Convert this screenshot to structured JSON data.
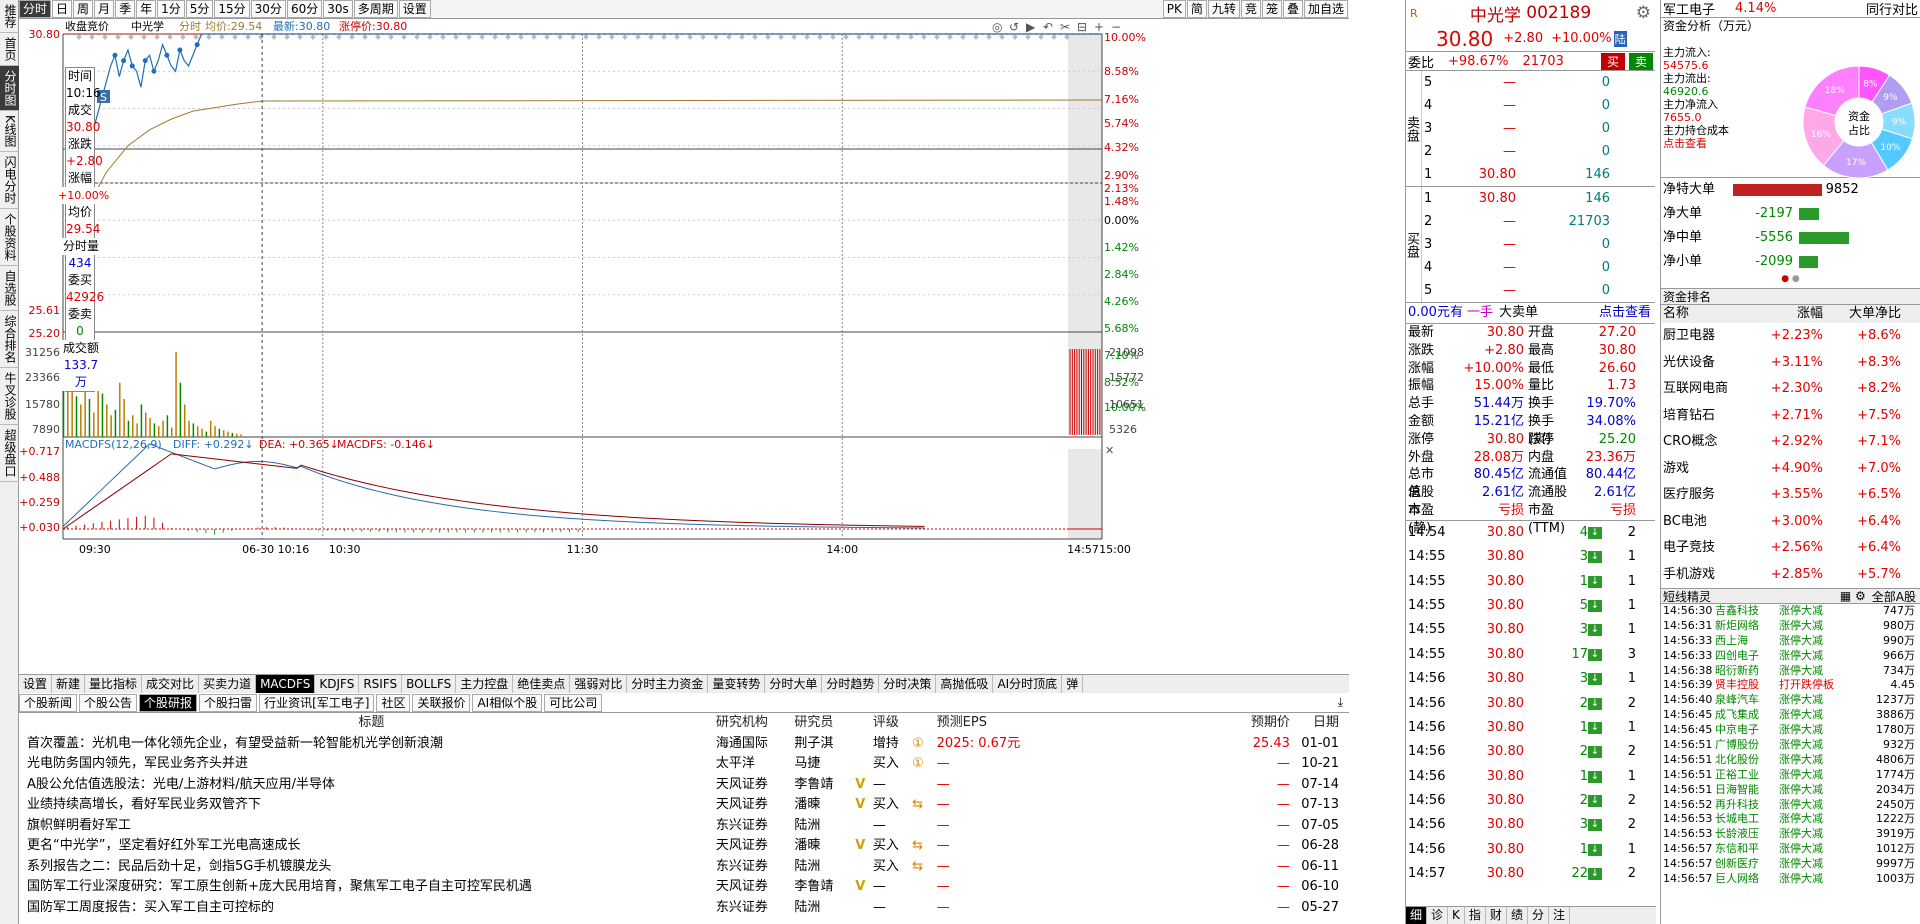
{
  "leftnav": [
    "推荐",
    "首页",
    "分时图",
    "K线图",
    "闪电分时",
    "个股资料",
    "自选股",
    "综合排名",
    "牛叉诊股",
    "超级盘口"
  ],
  "toolbar": {
    "items": [
      "分时",
      "日",
      "周",
      "月",
      "季",
      "年",
      "1分",
      "5分",
      "15分",
      "30分",
      "60分",
      "30s",
      "多周期",
      "设置"
    ],
    "right": [
      "PK",
      "简",
      "九转",
      "竞",
      "笼",
      "叠",
      "加自选"
    ]
  },
  "chart": {
    "legend": {
      "collect": "收盘竞价",
      "name": "中光学",
      "ma_label": "分时",
      "avg_label": "均价:29.54",
      "latest_label": "最新:30.80",
      "limit_label": "涨停价:30.80"
    },
    "price_axis": {
      "left": [
        "30.80",
        "25.61",
        "25.20"
      ],
      "right": [
        "10.00%",
        "8.58%",
        "7.16%",
        "5.74%",
        "4.32%",
        "2.90%",
        "2.13%",
        "1.48%",
        "0.00%",
        "1.42%",
        "2.84%",
        "4.26%",
        "5.68%",
        "7.10%",
        "8.52%",
        "10.00%"
      ]
    },
    "vol_axis": {
      "left": [
        "31256",
        "23366",
        "15780",
        "7890"
      ],
      "right": [
        "21098",
        "15772",
        "10651",
        "5326"
      ]
    },
    "macd_legend": {
      "name": "MACDFS(12,26,9)",
      "diff": "DIFF: +0.292↓",
      "dea": "DEA: +0.365↓",
      "macdfs": "MACDFS: -0.146↓"
    },
    "macd_axis": [
      "+0.717",
      "+0.488",
      "+0.259",
      "+0.030"
    ],
    "time_axis": [
      "09:30",
      "06-30 10:16",
      "10:30",
      "11:30",
      "14:00",
      "14:57",
      "15:00"
    ],
    "marker": "S"
  },
  "infobox": {
    "time_l": "时间",
    "time": "10:16",
    "cj_l": "成交",
    "cj": "30.80",
    "zd_l": "涨跌",
    "zd": "+2.80",
    "zf_l": "涨幅",
    "zf": "+10.00%",
    "jj_l": "均价",
    "jj": "29.54",
    "fsl_l": "分时量",
    "fsl": "434",
    "wm_l": "委买",
    "wm": "42926",
    "ws_l": "委卖",
    "ws": "0",
    "cje_l": "成交额",
    "cje": "133.7万"
  },
  "bottomtabs": [
    "设置",
    "新建",
    "量比指标",
    "成交对比",
    "买卖力道",
    "MACDFS",
    "KDJFS",
    "RSIFS",
    "BOLLFS",
    "主力控盘",
    "绝佳卖点",
    "强弱对比",
    "分时主力资金",
    "量变转势",
    "分时大单",
    "分时趋势",
    "分时决策",
    "高抛低吸",
    "AI分时顶底",
    "弹"
  ],
  "newstabs": [
    "个股新闻",
    "个股公告",
    "个股研报",
    "个股扫雷",
    "行业资讯[军工电子]",
    "社区",
    "关联报价",
    "AI相似个股",
    "可比公司"
  ],
  "news_header": {
    "title": "标题",
    "org": "研究机构",
    "analyst": "研究员",
    "rating": "评级",
    "eps": "预测EPS",
    "target": "预期价",
    "date": "日期"
  },
  "news": [
    {
      "title": "首次覆盖：光机电一体化领先企业，有望受益新一轮智能机光学创新浪潮",
      "org": "海通国际",
      "analyst": "荆子淇",
      "mark": "",
      "rating": "增持",
      "icon": "①",
      "eps": "2025: 0.67元",
      "target": "25.43",
      "date": "01-01"
    },
    {
      "title": "光电防务国内领先，军民业务齐头并进",
      "org": "太平洋",
      "analyst": "马捷",
      "mark": "",
      "rating": "买入",
      "icon": "①",
      "eps": "—",
      "target": "—",
      "date": "10-21"
    },
    {
      "title": "A股公允估值选股法：光电/上游材料/航天应用/半导体",
      "org": "天风证券",
      "analyst": "李鲁靖",
      "mark": "V",
      "rating": "—",
      "icon": "",
      "eps": "—",
      "target": "—",
      "date": "07-14"
    },
    {
      "title": "业绩持续高增长，看好军民业务双管齐下",
      "org": "天风证券",
      "analyst": "潘暕",
      "mark": "V",
      "rating": "买入",
      "icon": "⇆",
      "eps": "—",
      "target": "—",
      "date": "07-13"
    },
    {
      "title": "旗帜鲜明看好军工",
      "org": "东兴证券",
      "analyst": "陆洲",
      "mark": "",
      "rating": "—",
      "icon": "",
      "eps": "—",
      "target": "—",
      "date": "07-05"
    },
    {
      "title": "更名“中光学”，坚定看好红外军工光电高速成长",
      "org": "天风证券",
      "analyst": "潘暕",
      "mark": "V",
      "rating": "买入",
      "icon": "⇆",
      "eps": "—",
      "target": "—",
      "date": "06-28"
    },
    {
      "title": "系列报告之二：民品后劲十足，剑指5G手机镀膜龙头",
      "org": "东兴证券",
      "analyst": "陆洲",
      "mark": "",
      "rating": "买入",
      "icon": "⇆",
      "eps": "—",
      "target": "—",
      "date": "06-11"
    },
    {
      "title": "国防军工行业深度研究：军工原生创新+庞大民用培育，聚焦军工电子自主可控军民机遇",
      "org": "天风证券",
      "analyst": "李鲁靖",
      "mark": "V",
      "rating": "—",
      "icon": "",
      "eps": "—",
      "target": "—",
      "date": "06-10"
    },
    {
      "title": "国防军工周度报告：买入军工自主可控标的",
      "org": "东兴证券",
      "analyst": "陆洲",
      "mark": "",
      "rating": "—",
      "icon": "",
      "eps": "—",
      "target": "—",
      "date": "05-27"
    }
  ],
  "stock": {
    "badge": "R",
    "name": "中光学",
    "code": "002189",
    "price": "30.80",
    "change": "+2.80",
    "pct": "+10.00%",
    "tag": "陆",
    "wb_l": "委比",
    "wb": "+98.67%",
    "wc": "21703",
    "buy": "买",
    "sell": "卖"
  },
  "orderbook": {
    "sell_label": "卖盘",
    "buy_label": "买盘",
    "sell": [
      {
        "i": "5",
        "p": "—",
        "v": "0"
      },
      {
        "i": "4",
        "p": "—",
        "v": "0"
      },
      {
        "i": "3",
        "p": "—",
        "v": "0"
      },
      {
        "i": "2",
        "p": "—",
        "v": "0"
      },
      {
        "i": "1",
        "p": "30.80",
        "v": "146"
      }
    ],
    "buy": [
      {
        "i": "1",
        "p": "30.80",
        "v": "146"
      },
      {
        "i": "2",
        "p": "—",
        "v": "21703"
      },
      {
        "i": "3",
        "p": "—",
        "v": "0"
      },
      {
        "i": "4",
        "p": "—",
        "v": "0"
      },
      {
        "i": "5",
        "p": "—",
        "v": "0"
      }
    ]
  },
  "bigorder": {
    "amt": "0.00元有",
    "hands": "一手",
    "label": "大卖单",
    "link": "点击查看"
  },
  "stats": [
    [
      "最新",
      "30.80",
      "开盘",
      "27.20"
    ],
    [
      "涨跌",
      "+2.80",
      "最高",
      "30.80"
    ],
    [
      "涨幅",
      "+10.00%",
      "最低",
      "26.60"
    ],
    [
      "振幅",
      "15.00%",
      "量比",
      "1.73"
    ],
    [
      "总手",
      "51.44万",
      "换手",
      "19.70%"
    ],
    [
      "金额",
      "15.21亿",
      "换手(实)",
      "34.08%"
    ],
    [
      "涨停",
      "30.80",
      "跌停",
      "25.20"
    ],
    [
      "外盘",
      "28.08万",
      "内盘",
      "23.36万"
    ],
    [
      "总市值",
      "80.45亿",
      "流通值",
      "80.44亿"
    ],
    [
      "总股本",
      "2.61亿",
      "流通股",
      "2.61亿"
    ],
    [
      "市盈(静)",
      "亏损",
      "市盈(TTM)",
      "亏损"
    ]
  ],
  "ticks": [
    {
      "t": "14:54",
      "p": "30.80",
      "v": "4",
      "n": "2"
    },
    {
      "t": "14:55",
      "p": "30.80",
      "v": "3",
      "n": "1"
    },
    {
      "t": "14:55",
      "p": "30.80",
      "v": "1",
      "n": "1"
    },
    {
      "t": "14:55",
      "p": "30.80",
      "v": "5",
      "n": "1"
    },
    {
      "t": "14:55",
      "p": "30.80",
      "v": "3",
      "n": "1"
    },
    {
      "t": "14:55",
      "p": "30.80",
      "v": "17",
      "n": "3"
    },
    {
      "t": "14:56",
      "p": "30.80",
      "v": "3",
      "n": "1"
    },
    {
      "t": "14:56",
      "p": "30.80",
      "v": "2",
      "n": "2"
    },
    {
      "t": "14:56",
      "p": "30.80",
      "v": "1",
      "n": "1"
    },
    {
      "t": "14:56",
      "p": "30.80",
      "v": "2",
      "n": "2"
    },
    {
      "t": "14:56",
      "p": "30.80",
      "v": "1",
      "n": "1"
    },
    {
      "t": "14:56",
      "p": "30.80",
      "v": "2",
      "n": "2"
    },
    {
      "t": "14:56",
      "p": "30.80",
      "v": "3",
      "n": "2"
    },
    {
      "t": "14:56",
      "p": "30.80",
      "v": "1",
      "n": "1"
    },
    {
      "t": "14:57",
      "p": "30.80",
      "v": "22",
      "n": "2"
    }
  ],
  "rp_btabs": [
    "细",
    "诊",
    "K",
    "指",
    "财",
    "绩",
    "分",
    "注"
  ],
  "sector": {
    "name": "军工电子",
    "pct": "4.14%",
    "link": "同行对比"
  },
  "fund": {
    "title": "资金分析（万元）",
    "in_l": "主力流入:",
    "in": "54575.6",
    "out_l": "主力流出:",
    "out": "46920.6",
    "net_l": "主力净流入",
    "net": "7655.0",
    "cost_l": "主力持仓成本",
    "cost": "点击查看",
    "donut": "资金占比",
    "pcts": [
      "8%",
      "9%",
      "9%",
      "10%",
      "17%",
      "16%",
      "18%"
    ]
  },
  "netflow": [
    {
      "l": "净特大单",
      "v": "9852"
    },
    {
      "l": "净大单",
      "v": "-2197"
    },
    {
      "l": "净中单",
      "v": "-5556"
    },
    {
      "l": "净小单",
      "v": "-2099"
    }
  ],
  "rank": {
    "title": "资金排名",
    "h1": "名称",
    "h2": "涨幅",
    "h3": "大单净比",
    "rows": [
      [
        "厨卫电器",
        "+2.23%",
        "+8.6%"
      ],
      [
        "光伏设备",
        "+3.11%",
        "+8.3%"
      ],
      [
        "互联网电商",
        "+2.30%",
        "+8.2%"
      ],
      [
        "培育钻石",
        "+2.71%",
        "+7.5%"
      ],
      [
        "CRO概念",
        "+2.92%",
        "+7.1%"
      ],
      [
        "游戏",
        "+4.90%",
        "+7.0%"
      ],
      [
        "医疗服务",
        "+3.55%",
        "+6.5%"
      ],
      [
        "BC电池",
        "+3.00%",
        "+6.4%"
      ],
      [
        "电子竞技",
        "+2.56%",
        "+6.4%"
      ],
      [
        "手机游戏",
        "+2.85%",
        "+5.7%"
      ]
    ]
  },
  "short": {
    "title": "短线精灵",
    "filter": "全部A股",
    "rows": [
      [
        "14:56:30",
        "吉鑫科技",
        "涨停大减",
        "747万"
      ],
      [
        "14:56:31",
        "新炬网络",
        "涨停大减",
        "980万"
      ],
      [
        "14:56:33",
        "西上海",
        "涨停大减",
        "990万"
      ],
      [
        "14:56:33",
        "四创电子",
        "涨停大减",
        "966万"
      ],
      [
        "14:56:38",
        "昭衍新药",
        "涨停大减",
        "734万"
      ],
      [
        "14:56:39",
        "贤丰控股",
        "打开跌停板",
        "4.45"
      ],
      [
        "14:56:40",
        "泉峰汽车",
        "涨停大减",
        "1237万"
      ],
      [
        "14:56:45",
        "成飞集成",
        "涨停大减",
        "3886万"
      ],
      [
        "14:56:45",
        "中京电子",
        "涨停大减",
        "1780万"
      ],
      [
        "14:56:51",
        "广博股份",
        "涨停大减",
        "932万"
      ],
      [
        "14:56:51",
        "北化股份",
        "涨停大减",
        "4806万"
      ],
      [
        "14:56:51",
        "正裕工业",
        "涨停大减",
        "1774万"
      ],
      [
        "14:56:51",
        "日海智能",
        "涨停大减",
        "2034万"
      ],
      [
        "14:56:52",
        "再升科技",
        "涨停大减",
        "2450万"
      ],
      [
        "14:56:53",
        "长城电工",
        "涨停大减",
        "1222万"
      ],
      [
        "14:56:53",
        "长龄液压",
        "涨停大减",
        "3919万"
      ],
      [
        "14:56:57",
        "东信和平",
        "涨停大减",
        "1012万"
      ],
      [
        "14:56:57",
        "创新医疗",
        "涨停大减",
        "9997万"
      ],
      [
        "14:56:57",
        "巨人网络",
        "涨停大减",
        "1003万"
      ]
    ]
  },
  "colors": {
    "up": "#e00000",
    "down": "#008800",
    "price": "#1e6fb5",
    "avg": "#a07a30"
  }
}
